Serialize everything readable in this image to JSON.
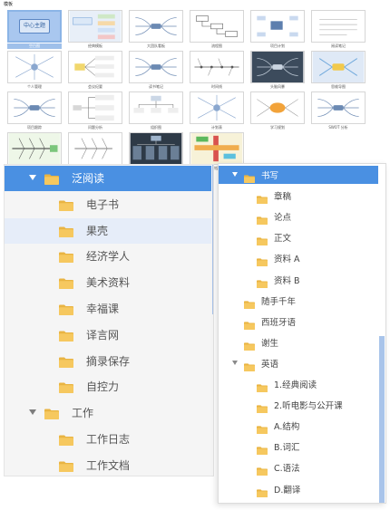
{
  "gallery": {
    "heading": "模板",
    "templates": [
      {
        "caption": "空白图",
        "kind": "blank",
        "center_text": "中心主题",
        "selected": true
      },
      {
        "caption": "经典模板",
        "kind": "classic",
        "selected": false
      },
      {
        "caption": "大团队看板",
        "kind": "mindmap",
        "selected": false
      },
      {
        "caption": "流程图",
        "kind": "flow",
        "selected": false
      },
      {
        "caption": "项目计划",
        "kind": "plan",
        "selected": false
      },
      {
        "caption": "阅读笔记",
        "kind": "notes",
        "selected": false
      },
      {
        "caption": "个人管理",
        "kind": "radial",
        "selected": false
      },
      {
        "caption": "会议纪要",
        "kind": "meeting",
        "selected": false
      },
      {
        "caption": "读书笔记",
        "kind": "mindmap",
        "selected": false
      },
      {
        "caption": "时间线",
        "kind": "timeline",
        "selected": false
      },
      {
        "caption": "头脑风暴",
        "kind": "dark",
        "selected": false
      },
      {
        "caption": "思维导图",
        "kind": "colorful",
        "selected": false
      },
      {
        "caption": "项目跟踪",
        "kind": "mindmap",
        "selected": false
      },
      {
        "caption": "问题分析",
        "kind": "tree",
        "selected": false
      },
      {
        "caption": "组织图",
        "kind": "org",
        "selected": false
      },
      {
        "caption": "计划表",
        "kind": "radial",
        "selected": false
      },
      {
        "caption": "学习规划",
        "kind": "yellow",
        "selected": false
      },
      {
        "caption": "SWOT 分析",
        "kind": "mindmap",
        "selected": false
      },
      {
        "caption": "鱼骨图 分析",
        "kind": "fishbone",
        "selected": false
      },
      {
        "caption": "原因 - 结果",
        "kind": "fishbone2",
        "selected": false
      },
      {
        "caption": "架构图",
        "kind": "darkorg",
        "selected": false
      },
      {
        "caption": "课程表",
        "kind": "matrix",
        "selected": false
      }
    ]
  },
  "left_tree": {
    "items": [
      {
        "label": "泛阅读",
        "level": 0,
        "expanded": true,
        "selected": true
      },
      {
        "label": "电子书",
        "level": 1
      },
      {
        "label": "果壳",
        "level": 1,
        "hover": true
      },
      {
        "label": "经济学人",
        "level": 1
      },
      {
        "label": "美术资料",
        "level": 1
      },
      {
        "label": "幸福课",
        "level": 1
      },
      {
        "label": "译言网",
        "level": 1
      },
      {
        "label": "摘录保存",
        "level": 1
      },
      {
        "label": "自控力",
        "level": 1
      },
      {
        "label": "工作",
        "level": 0,
        "expanded": true
      },
      {
        "label": "工作日志",
        "level": 1
      },
      {
        "label": "工作文档",
        "level": 1
      }
    ]
  },
  "right_tree": {
    "items": [
      {
        "label": "书写",
        "level": 0,
        "expanded": true,
        "selected": true
      },
      {
        "label": "章稿",
        "level": 1
      },
      {
        "label": "论点",
        "level": 1
      },
      {
        "label": "正文",
        "level": 1
      },
      {
        "label": "资料 A",
        "level": 1
      },
      {
        "label": "资料 B",
        "level": 1
      },
      {
        "label": "随手千年",
        "level": 0
      },
      {
        "label": "西班牙语",
        "level": 0
      },
      {
        "label": "谢生",
        "level": 0
      },
      {
        "label": "英语",
        "level": 0,
        "expanded": true
      },
      {
        "label": "1.经典阅读",
        "level": 1
      },
      {
        "label": "2.听电影与公开课",
        "level": 1
      },
      {
        "label": "A.结构",
        "level": 1
      },
      {
        "label": "B.词汇",
        "level": 1
      },
      {
        "label": "C.语法",
        "level": 1
      },
      {
        "label": "D.翻译",
        "level": 1
      }
    ]
  },
  "colors": {
    "selected_row": "#4a90e2",
    "hover_row": "#e6edf9",
    "folder_fill": "#f6c85f",
    "folder_tab": "#e9b442",
    "scrollbar": "#a9c4ea"
  }
}
